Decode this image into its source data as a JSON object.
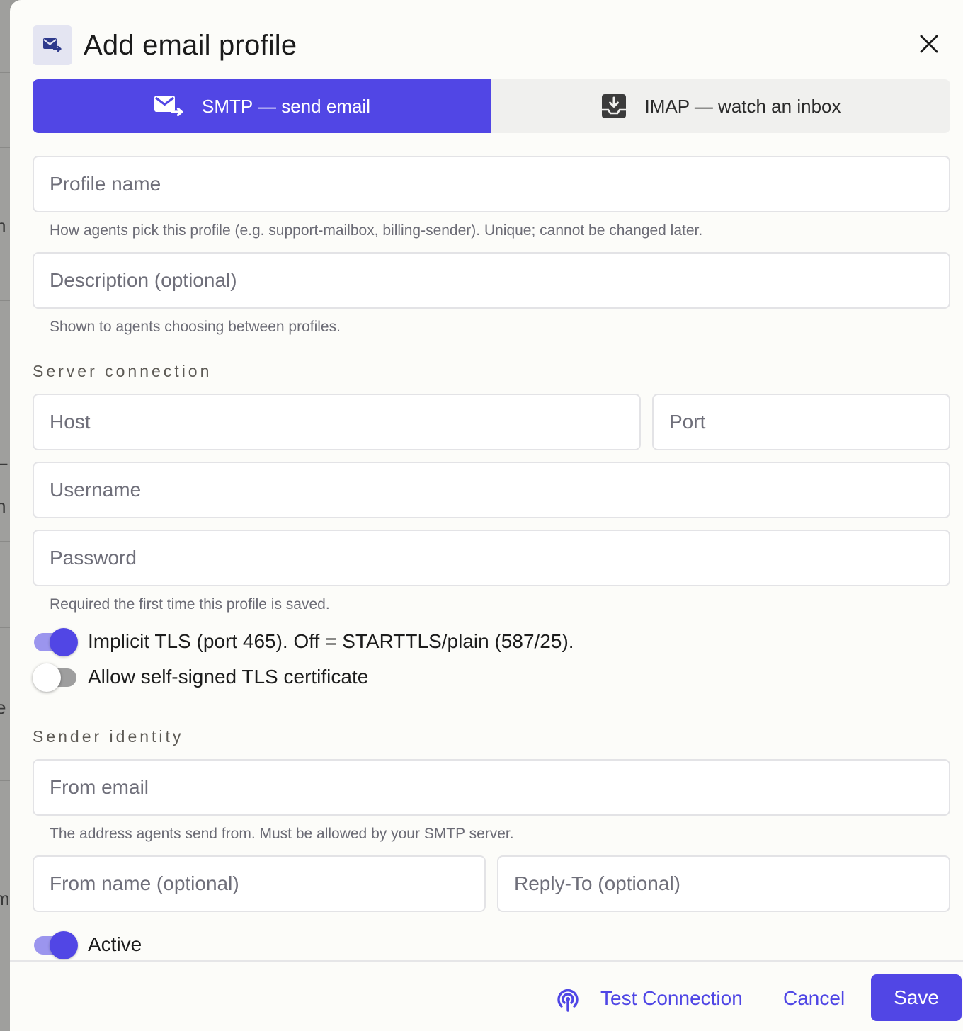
{
  "backdrop": {
    "fragments": [
      "n",
      "–",
      "n",
      "e",
      "m"
    ]
  },
  "dialog": {
    "title": "Add email profile",
    "icons": {
      "header": "mail-send-icon",
      "close": "close-icon"
    }
  },
  "tabs": [
    {
      "label": "SMTP — send email",
      "icon": "mail-send-icon",
      "active": true
    },
    {
      "label": "IMAP — watch an inbox",
      "icon": "inbox-download-icon",
      "active": false
    }
  ],
  "fields": {
    "profile_name": {
      "placeholder": "Profile name",
      "value": "",
      "help": "How agents pick this profile (e.g. support-mailbox, billing-sender). Unique; cannot be changed later."
    },
    "description": {
      "placeholder": "Description (optional)",
      "value": "",
      "help": "Shown to agents choosing between profiles."
    },
    "host": {
      "placeholder": "Host",
      "value": ""
    },
    "port": {
      "placeholder": "Port",
      "value": ""
    },
    "username": {
      "placeholder": "Username",
      "value": ""
    },
    "password": {
      "placeholder": "Password",
      "value": "",
      "help": "Required the first time this profile is saved."
    },
    "from_email": {
      "placeholder": "From email",
      "value": "",
      "help": "The address agents send from. Must be allowed by your SMTP server."
    },
    "from_name": {
      "placeholder": "From name (optional)",
      "value": ""
    },
    "reply_to": {
      "placeholder": "Reply-To (optional)",
      "value": ""
    }
  },
  "sections": {
    "server": "Server connection",
    "sender": "Sender identity"
  },
  "toggles": {
    "implicit_tls": {
      "label": "Implicit TLS (port 465). Off = STARTTLS/plain (587/25).",
      "on": true
    },
    "self_signed": {
      "label": "Allow self-signed TLS certificate",
      "on": false
    },
    "active": {
      "label": "Active",
      "on": true
    }
  },
  "footer": {
    "test_label": "Test Connection",
    "test_icon": "broadcast-icon",
    "cancel_label": "Cancel",
    "save_label": "Save"
  },
  "colors": {
    "accent": "#5146e5",
    "accent_light": "#9b95ee",
    "dialog_bg": "#fcfcf9"
  }
}
